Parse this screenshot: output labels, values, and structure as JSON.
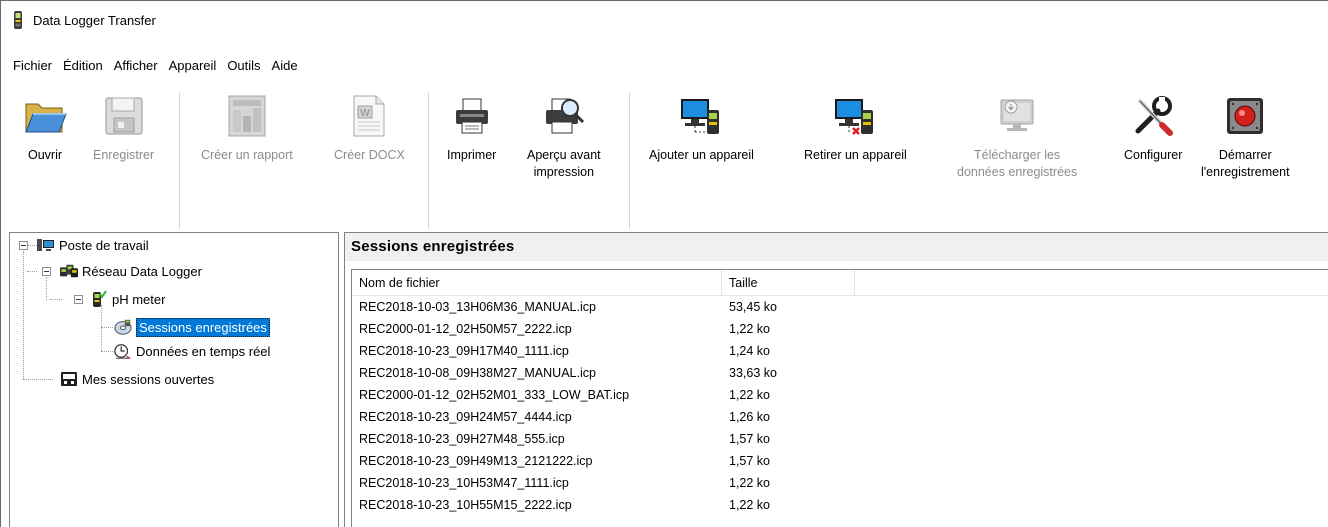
{
  "window": {
    "title": "Data Logger Transfer"
  },
  "menu": [
    "Fichier",
    "Édition",
    "Afficher",
    "Appareil",
    "Outils",
    "Aide"
  ],
  "toolbar": {
    "open": "Ouvrir",
    "save": "Enregistrer",
    "create_report": "Créer un rapport",
    "create_docx": "Créer DOCX",
    "print": "Imprimer",
    "print_preview_1": "Aperçu avant",
    "print_preview_2": "impression",
    "add_device": "Ajouter un appareil",
    "remove_device": "Retirer un appareil",
    "download_1": "Télécharger les",
    "download_2": "données enregistrées",
    "configure": "Configurer",
    "start_1": "Démarrer",
    "start_2": "l'enregistrement"
  },
  "tree": {
    "workstation": "Poste de travail",
    "network": "Réseau Data Logger",
    "device": "pH meter",
    "sessions": "Sessions enregistrées",
    "realtime": "Données en temps réel",
    "open_sessions": "Mes sessions ouvertes"
  },
  "panel": {
    "title": "Sessions enregistrées",
    "col_name": "Nom de fichier",
    "col_size": "Taille"
  },
  "files": [
    {
      "name": "REC2018-10-03_13H06M36_MANUAL.icp",
      "size": "53,45 ko"
    },
    {
      "name": "REC2000-01-12_02H50M57_2222.icp",
      "size": "1,22 ko"
    },
    {
      "name": "REC2018-10-23_09H17M40_1111.icp",
      "size": "1,24 ko"
    },
    {
      "name": "REC2018-10-08_09H38M27_MANUAL.icp",
      "size": "33,63 ko"
    },
    {
      "name": "REC2000-01-12_02H52M01_333_LOW_BAT.icp",
      "size": "1,22 ko"
    },
    {
      "name": "REC2018-10-23_09H24M57_4444.icp",
      "size": "1,26 ko"
    },
    {
      "name": "REC2018-10-23_09H27M48_555.icp",
      "size": "1,57 ko"
    },
    {
      "name": "REC2018-10-23_09H49M13_2121222.icp",
      "size": "1,57 ko"
    },
    {
      "name": "REC2018-10-23_10H53M47_1111.icp",
      "size": "1,22 ko"
    },
    {
      "name": "REC2018-10-23_10H55M15_2222.icp",
      "size": "1,22 ko"
    }
  ]
}
